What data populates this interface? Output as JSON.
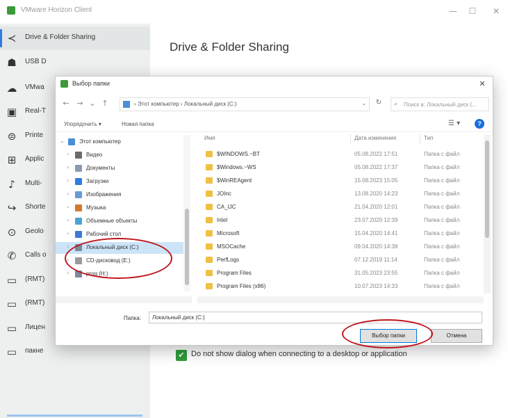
{
  "app": {
    "title": "VMware Horizon Client",
    "win_minimize": "—",
    "win_maximize": "☐",
    "win_close": "✕"
  },
  "sidebar": {
    "back_icon": "chevron-left-icon",
    "items": [
      {
        "label": "Drive & Folder Sharing",
        "icon": "share-icon",
        "glyph": "≺",
        "active": true
      },
      {
        "label": "USB D",
        "icon": "usb-icon",
        "glyph": "☗"
      },
      {
        "label": "VMwa",
        "icon": "cloud-icon",
        "glyph": "☁"
      },
      {
        "label": "Real-T",
        "icon": "camera-icon",
        "glyph": "▣"
      },
      {
        "label": "Printe",
        "icon": "printer-icon",
        "glyph": "⊜"
      },
      {
        "label": "Applic",
        "icon": "apps-icon",
        "glyph": "⊞"
      },
      {
        "label": "Multi-",
        "icon": "multimedia-icon",
        "glyph": "♪"
      },
      {
        "label": "Shorte",
        "icon": "shortcut-icon",
        "glyph": "↪"
      },
      {
        "label": "Geolo",
        "icon": "location-icon",
        "glyph": "⊙"
      },
      {
        "label": "Calls o",
        "icon": "phone-icon",
        "glyph": "✆"
      },
      {
        "label": "(RMT)",
        "icon": "desktop-icon",
        "glyph": "▭"
      },
      {
        "label": "(RMT)",
        "icon": "desktop-icon",
        "glyph": "▭"
      },
      {
        "label": "Лицен",
        "icon": "desktop-icon",
        "glyph": "▭"
      },
      {
        "label": "пакне",
        "icon": "desktop-icon",
        "glyph": "▭"
      }
    ]
  },
  "main": {
    "title": "Drive & Folder Sharing",
    "checkbox_label": "Do not show dialog when connecting to a desktop or application",
    "checkbox_checked": true
  },
  "dialog": {
    "title": "Выбор папки",
    "close": "✕",
    "address": "›  Этот компьютер  ›  Локальный диск (C:)",
    "search_placeholder": "Поиск в: Локальный диск (...",
    "organize": "Упорядочить ▾",
    "new_folder": "Новая папка",
    "tree": [
      {
        "label": "Этот компьютер",
        "color": "#4a8fd6",
        "level": 0,
        "expanded": true
      },
      {
        "label": "Видео",
        "color": "#6b6b6b",
        "level": 1
      },
      {
        "label": "Документы",
        "color": "#8a9bb0",
        "level": 1
      },
      {
        "label": "Загрузки",
        "color": "#2f7ce0",
        "level": 1
      },
      {
        "label": "Изображения",
        "color": "#6a9ad6",
        "level": 1
      },
      {
        "label": "Музыка",
        "color": "#d17a2e",
        "level": 1
      },
      {
        "label": "Объемные объекты",
        "color": "#4aa3d6",
        "level": 1
      },
      {
        "label": "Рабочий стол",
        "color": "#3a7bd5",
        "level": 1
      },
      {
        "label": "Локальный диск (C:)",
        "color": "#7a8a9a",
        "level": 1,
        "selected": true
      },
      {
        "label": "CD-дисковод (E:)",
        "color": "#9a9a9a",
        "level": 1
      },
      {
        "label": "prog (H:)",
        "color": "#7a8a9a",
        "level": 1
      }
    ],
    "columns": {
      "name": "Имя",
      "date": "Дата изменения",
      "type": "Тип"
    },
    "files": [
      {
        "name": "$WINDOWS.~BT",
        "date": "05.08.2022 17:51",
        "type": "Папка с файл"
      },
      {
        "name": "$Windows.~WS",
        "date": "05.08.2022 17:37",
        "type": "Папка с файл"
      },
      {
        "name": "$WinREAgent",
        "date": "15.08.2023 15:05",
        "type": "Папка с файл"
      },
      {
        "name": "JOInc",
        "date": "13.08.2020 14:23",
        "type": "Папка с файл"
      },
      {
        "name": "CA_IJC",
        "date": "21.04.2020 12:01",
        "type": "Папка с файл"
      },
      {
        "name": "Intel",
        "date": "23.07.2020 12:39",
        "type": "Папка с файл"
      },
      {
        "name": "Microsoft",
        "date": "15.04.2020 14:41",
        "type": "Папка с файл"
      },
      {
        "name": "MSOCache",
        "date": "09.04.2020 14:38",
        "type": "Папка с файл"
      },
      {
        "name": "PerfLogs",
        "date": "07.12.2019 11:14",
        "type": "Папка с файл"
      },
      {
        "name": "Program Files",
        "date": "31.05.2023 23:55",
        "type": "Папка с файл"
      },
      {
        "name": "Program Files (x86)",
        "date": "10.07.2023 14:33",
        "type": "Папка с файл"
      }
    ],
    "folder_label": "Папка:",
    "folder_value": "Локальный диск (C:)",
    "select_button": "Выбор папки",
    "cancel_button": "Отмена"
  }
}
